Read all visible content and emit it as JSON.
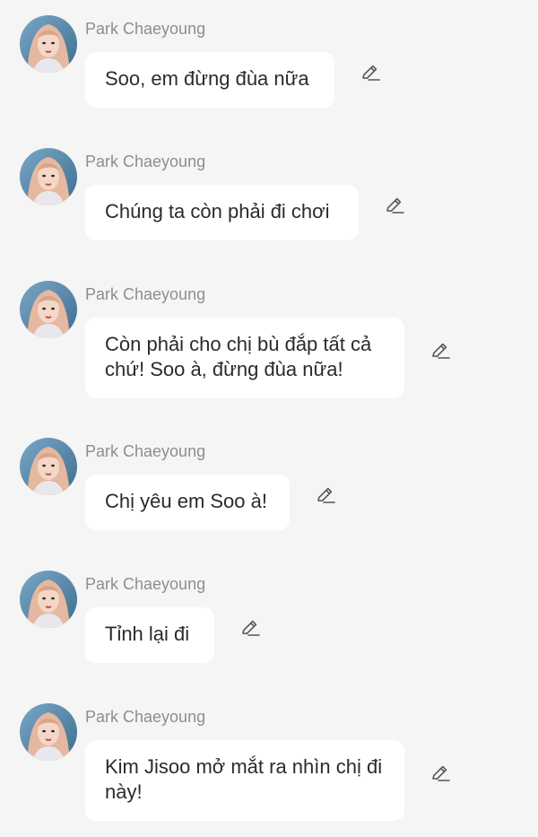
{
  "colors": {
    "background": "#f5f5f5",
    "bubble": "#ffffff",
    "sender_text": "#8e8e8e",
    "message_text": "#2b2b2b",
    "icon": "#555555"
  },
  "messages": [
    {
      "sender": "Park Chaeyoung",
      "text": "Soo, em đừng đùa nữa",
      "avatar_icon": "avatar-icon",
      "action_icon": "pencil-edit-icon"
    },
    {
      "sender": "Park Chaeyoung",
      "text": "Chúng ta còn phải đi chơi",
      "avatar_icon": "avatar-icon",
      "action_icon": "pencil-edit-icon"
    },
    {
      "sender": "Park Chaeyoung",
      "text": "Còn phải cho chị bù đắp tất cả chứ! Soo à, đừng đùa nữa!",
      "avatar_icon": "avatar-icon",
      "action_icon": "pencil-edit-icon"
    },
    {
      "sender": "Park Chaeyoung",
      "text": "Chị yêu em Soo à!",
      "avatar_icon": "avatar-icon",
      "action_icon": "pencil-edit-icon"
    },
    {
      "sender": "Park Chaeyoung",
      "text": "Tỉnh lại đi",
      "avatar_icon": "avatar-icon",
      "action_icon": "pencil-edit-icon"
    },
    {
      "sender": "Park Chaeyoung",
      "text": "Kim Jisoo mở mắt ra nhìn chị đi này!",
      "avatar_icon": "avatar-icon",
      "action_icon": "pencil-edit-icon"
    }
  ]
}
